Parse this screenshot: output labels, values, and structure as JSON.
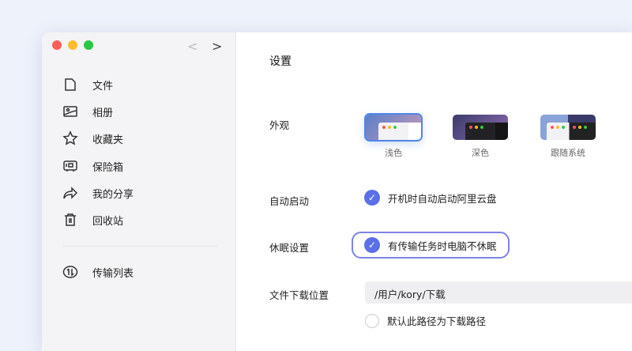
{
  "sidebar": {
    "nav_back": "<",
    "nav_forward": ">",
    "items": [
      {
        "label": "文件",
        "icon": "file-icon"
      },
      {
        "label": "相册",
        "icon": "photo-icon"
      },
      {
        "label": "收藏夹",
        "icon": "star-icon"
      },
      {
        "label": "保险箱",
        "icon": "safe-icon"
      },
      {
        "label": "我的分享",
        "icon": "share-icon"
      },
      {
        "label": "回收站",
        "icon": "trash-icon"
      }
    ],
    "transfer": {
      "label": "传输列表",
      "icon": "transfer-icon"
    }
  },
  "main": {
    "title": "设置",
    "appearance": {
      "label": "外观",
      "options": [
        "浅色",
        "深色",
        "跟随系统"
      ],
      "selected": "浅色"
    },
    "autostart": {
      "label": "自动启动",
      "option": "开机时自动启动阿里云盘",
      "checked": true
    },
    "sleep": {
      "label": "休眠设置",
      "option": "有传输任务时电脑不休眠",
      "checked": true
    },
    "download": {
      "label": "文件下载位置",
      "path": "/用户/kory/下载",
      "default_option": "默认此路径为下载路径",
      "default_checked": false
    }
  },
  "colors": {
    "accent": "#5b6fe6"
  }
}
